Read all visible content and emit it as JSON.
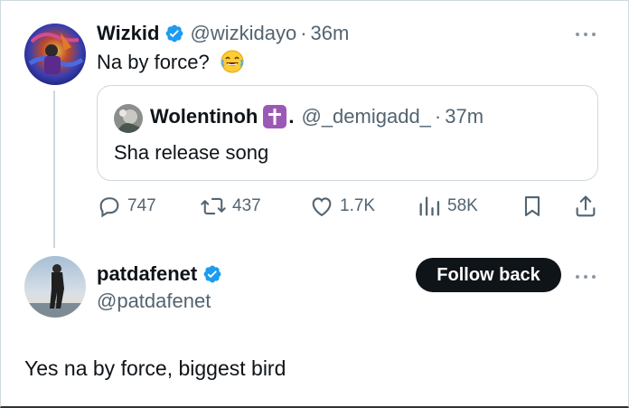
{
  "original_tweet": {
    "display_name": "Wizkid",
    "handle": "@wizkidayo",
    "separator": "·",
    "time": "36m",
    "text": "Na by force?",
    "emoji": "face-with-tears-of-joy",
    "more_icon": "more-horizontal-icon"
  },
  "quoted_tweet": {
    "display_name": "Wolentinoh",
    "cross_emoji": "latin-cross",
    "name_suffix": ".",
    "handle": "@_demigadd_",
    "separator": "·",
    "time": "37m",
    "text": "Sha release song"
  },
  "actions": {
    "replies": "747",
    "retweets": "437",
    "likes": "1.7K",
    "views": "58K"
  },
  "reply_tweet": {
    "display_name": "patdafenet",
    "handle": "@patdafenet",
    "follow_button": "Follow back",
    "text": "Yes na by force, biggest bird"
  },
  "colors": {
    "verified_blue": "#1d9bf0",
    "text_primary": "#0f1419",
    "text_secondary": "#536471",
    "border": "#cfd9de",
    "button_bg": "#0f1419",
    "cross_badge": "#9b59b6"
  }
}
